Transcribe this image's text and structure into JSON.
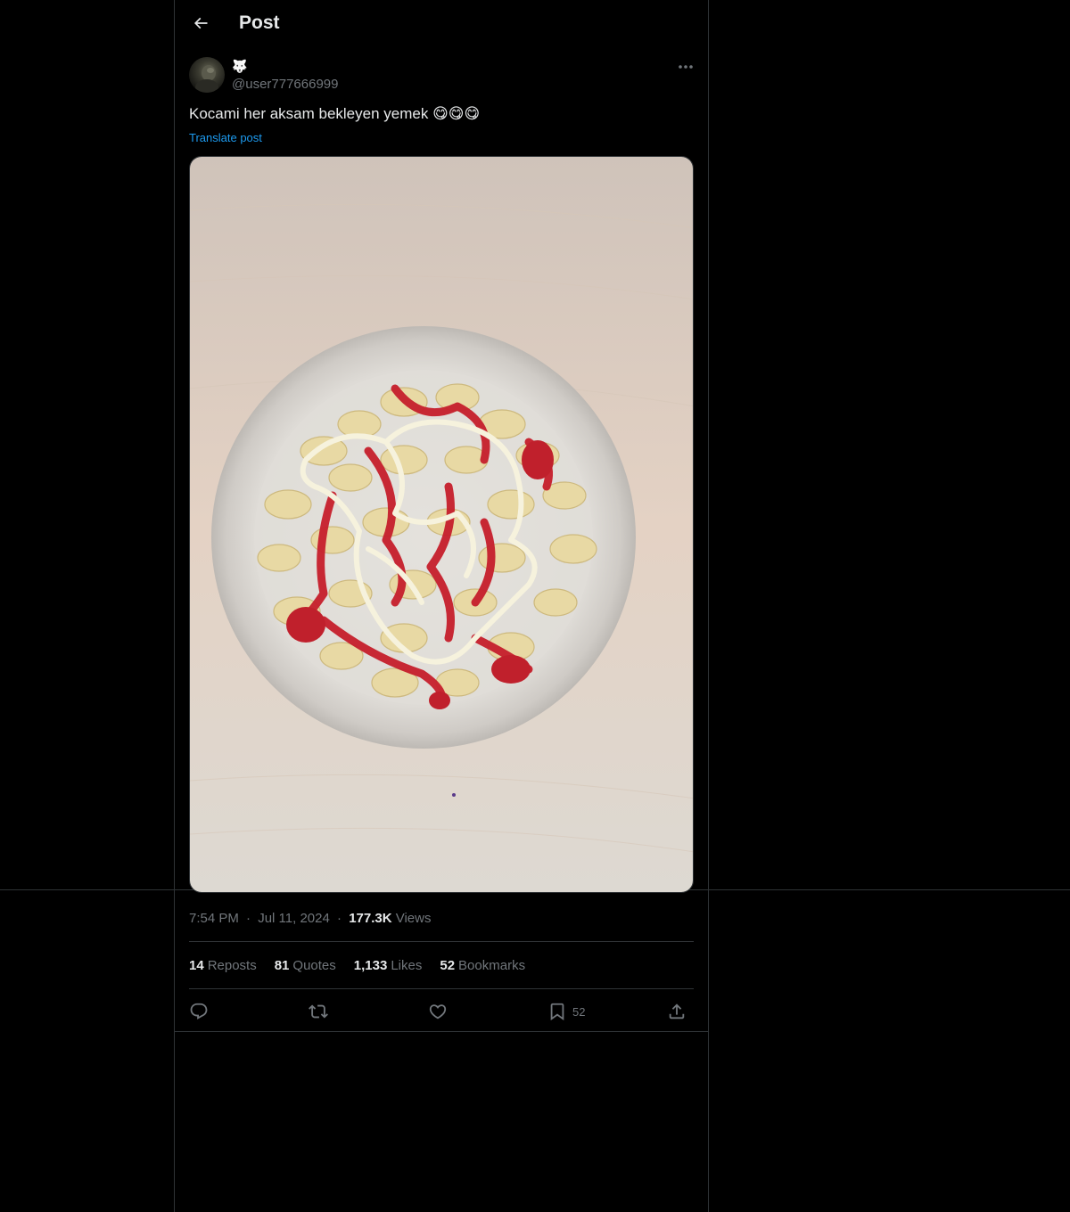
{
  "header": {
    "title": "Post"
  },
  "author": {
    "display_name": "🐺",
    "handle": "@user777666999"
  },
  "tweet": {
    "text": "Kocami her aksam bekleyen yemek 😋😋😋",
    "translate_label": "Translate post"
  },
  "meta": {
    "time": "7:54 PM",
    "dot1": "·",
    "date": "Jul 11, 2024",
    "dot2": "·",
    "views_count": "177.3K",
    "views_label": "Views"
  },
  "stats": {
    "reposts_count": "14",
    "reposts_label": "Reposts",
    "quotes_count": "81",
    "quotes_label": "Quotes",
    "likes_count": "1,133",
    "likes_label": "Likes",
    "bookmarks_count": "52",
    "bookmarks_label": "Bookmarks"
  },
  "actions": {
    "bookmark_count": "52"
  },
  "icons": {
    "back": "arrow-left-icon",
    "more": "more-horizontal-icon",
    "reply": "reply-icon",
    "repost": "repost-icon",
    "like": "heart-icon",
    "bookmark": "bookmark-icon",
    "share": "share-icon"
  },
  "colors": {
    "background": "#000000",
    "text_primary": "#e7e9ea",
    "text_secondary": "#71767b",
    "link": "#1d9bf0",
    "border": "#2f3336"
  }
}
